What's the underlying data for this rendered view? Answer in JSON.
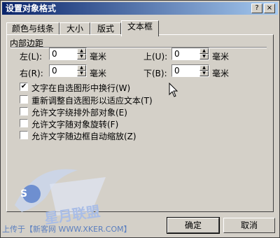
{
  "window": {
    "title": "设置对象格式",
    "help_btn": "?",
    "close_btn": "×"
  },
  "tabs": [
    {
      "label": "颜色与线条",
      "active": false
    },
    {
      "label": "大小",
      "active": false
    },
    {
      "label": "版式",
      "active": false
    },
    {
      "label": "文本框",
      "active": true
    }
  ],
  "margins": {
    "group_label": "内部边距",
    "left_label": "左(L):",
    "left_value": "0",
    "left_unit": "毫米",
    "top_label": "上(U):",
    "top_value": "0",
    "top_unit": "毫米",
    "right_label": "右(R):",
    "right_value": "0",
    "right_unit": "毫米",
    "bottom_label": "下(B):",
    "bottom_value": "0",
    "bottom_unit": "毫米"
  },
  "options": [
    {
      "label": "文字在自选图形中换行(W)",
      "checked": true
    },
    {
      "label": "重新调整自选图形以适应文本(T)",
      "checked": false
    },
    {
      "label": "允许文字绕排外部对象(E)",
      "checked": false
    },
    {
      "label": "允许文字随对象旋转(F)",
      "checked": false
    },
    {
      "label": "允许文字随边框自动缩放(Z)",
      "checked": false
    }
  ],
  "buttons": {
    "ok": "确定",
    "cancel": "取消"
  },
  "watermark": {
    "caption": "上传于【新客网 WWW.XKER.COM】",
    "logo_text": "星月联盟",
    "logo_letter": "S"
  },
  "colors": {
    "titlebar_start": "#0a246a",
    "titlebar_end": "#a6caf0",
    "face": "#d4d0c8",
    "watermark": "#5b7fbf"
  }
}
